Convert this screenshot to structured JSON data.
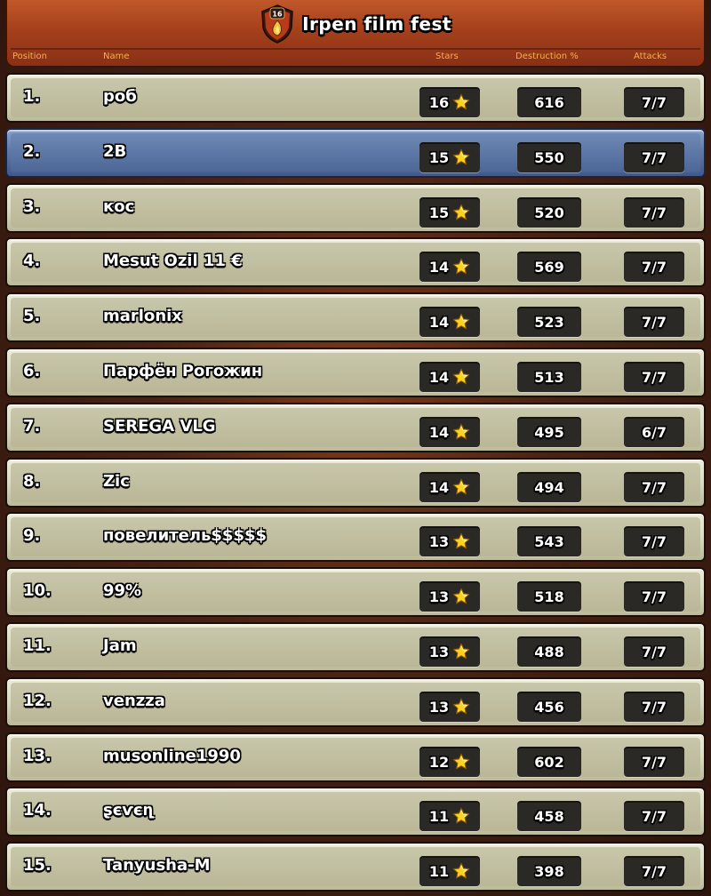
{
  "header": {
    "title": "Irpen film fest",
    "badge_level": "16",
    "columns": {
      "position": "Position",
      "name": "Name",
      "stars": "Stars",
      "destruction": "Destruction %",
      "attacks": "Attacks"
    }
  },
  "highlight_color": "#5e79a8",
  "icons": {
    "star": "star-icon",
    "badge": "clan-war-league-badge-icon"
  },
  "rows": [
    {
      "position": "1.",
      "name": "роб",
      "stars": "16",
      "destruction": "616",
      "attacks": "7/7"
    },
    {
      "position": "2.",
      "name": "2B",
      "stars": "15",
      "destruction": "550",
      "attacks": "7/7",
      "highlight": true
    },
    {
      "position": "3.",
      "name": "кос",
      "stars": "15",
      "destruction": "520",
      "attacks": "7/7"
    },
    {
      "position": "4.",
      "name": "Mesut Ozil 11 €",
      "stars": "14",
      "destruction": "569",
      "attacks": "7/7"
    },
    {
      "position": "5.",
      "name": "marlonix",
      "stars": "14",
      "destruction": "523",
      "attacks": "7/7"
    },
    {
      "position": "6.",
      "name": "Парфён Рогожин",
      "stars": "14",
      "destruction": "513",
      "attacks": "7/7"
    },
    {
      "position": "7.",
      "name": "SEREGA VLG",
      "stars": "14",
      "destruction": "495",
      "attacks": "6/7"
    },
    {
      "position": "8.",
      "name": "Zic",
      "stars": "14",
      "destruction": "494",
      "attacks": "7/7"
    },
    {
      "position": "9.",
      "name": "повелитель$$$$$",
      "stars": "13",
      "destruction": "543",
      "attacks": "7/7"
    },
    {
      "position": "10.",
      "name": "99%",
      "stars": "13",
      "destruction": "518",
      "attacks": "7/7"
    },
    {
      "position": "11.",
      "name": "Jam",
      "stars": "13",
      "destruction": "488",
      "attacks": "7/7"
    },
    {
      "position": "12.",
      "name": "venzza",
      "stars": "13",
      "destruction": "456",
      "attacks": "7/7"
    },
    {
      "position": "13.",
      "name": "musonline1990",
      "stars": "12",
      "destruction": "602",
      "attacks": "7/7"
    },
    {
      "position": "14.",
      "name": "ʂєѵєղ",
      "stars": "11",
      "destruction": "458",
      "attacks": "7/7"
    },
    {
      "position": "15.",
      "name": "Tanyusha-M",
      "stars": "11",
      "destruction": "398",
      "attacks": "7/7"
    }
  ]
}
